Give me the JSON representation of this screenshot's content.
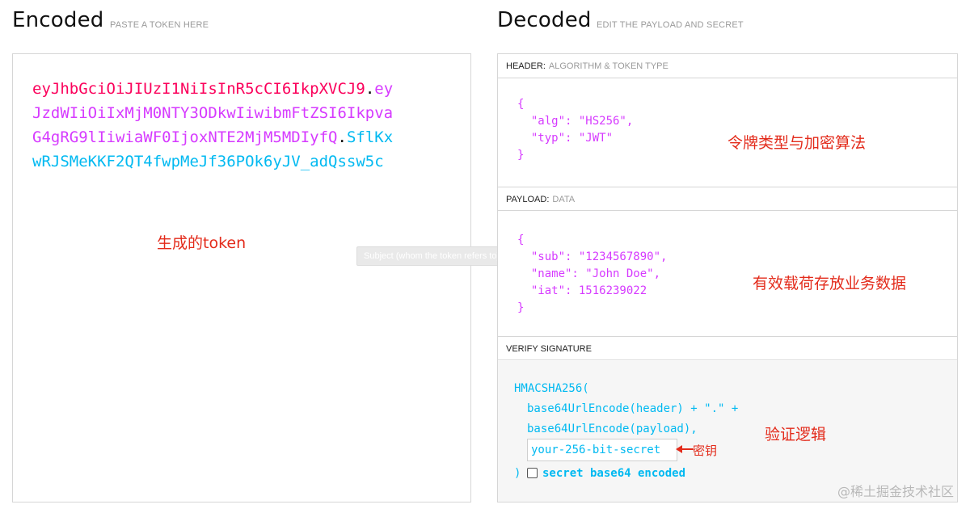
{
  "encoded": {
    "title": "Encoded",
    "subtitle": "PASTE A TOKEN HERE",
    "token_lines": [
      {
        "parts": [
          {
            "text": "eyJhbGciOiJIUzI1NiIsInR5cCI6IkpXVCJ9",
            "color": "red"
          },
          {
            "text": ".",
            "color": "black"
          },
          {
            "text": "ey",
            "color": "purple"
          }
        ]
      },
      {
        "parts": [
          {
            "text": "JzdWIiOiIxMjM0NTY3ODkwIiwibmFtZSI6Ikpva",
            "color": "purple"
          }
        ]
      },
      {
        "parts": [
          {
            "text": "G4gRG9lIiwiaWF0IjoxNTE2MjM5MDIyfQ",
            "color": "purple"
          },
          {
            "text": ".",
            "color": "black"
          },
          {
            "text": "SflKx",
            "color": "cyan"
          }
        ]
      },
      {
        "parts": [
          {
            "text": "wRJSMeKKF2QT4fwpMeJf36POk6yJV_adQssw5c",
            "color": "cyan"
          }
        ]
      }
    ],
    "annotation": "生成的token"
  },
  "tooltip": "Subject (whom the token refers to)",
  "decoded": {
    "title": "Decoded",
    "subtitle": "EDIT THE PAYLOAD AND SECRET",
    "header": {
      "label": "HEADER:",
      "sublabel": "ALGORITHM & TOKEN TYPE",
      "lines": [
        "{",
        "  \"alg\": \"HS256\",",
        "  \"typ\": \"JWT\"",
        "}"
      ],
      "annotation": "令牌类型与加密算法"
    },
    "payload": {
      "label": "PAYLOAD:",
      "sublabel": "DATA",
      "lines": [
        "{",
        "  \"sub\": \"1234567890\",",
        "  \"name\": \"John Doe\",",
        "  \"iat\": 1516239022",
        "}"
      ],
      "annotation": "有效载荷存放业务数据"
    },
    "verify": {
      "label": "VERIFY SIGNATURE",
      "line1": "HMACSHA256(",
      "line2": "base64UrlEncode(header) + \".\" +",
      "line3": "base64UrlEncode(payload),",
      "secret_placeholder": "your-256-bit-secret",
      "close_paren": ")",
      "checkbox_label": "secret base64 encoded",
      "secret_annotation": "密钥",
      "annotation": "验证逻辑"
    }
  },
  "watermark": "@稀土掘金技术社区",
  "colors": {
    "red": "#fb015b",
    "purple": "#d63aff",
    "cyan": "#00b9f1",
    "annotation": "#e32b1b"
  }
}
